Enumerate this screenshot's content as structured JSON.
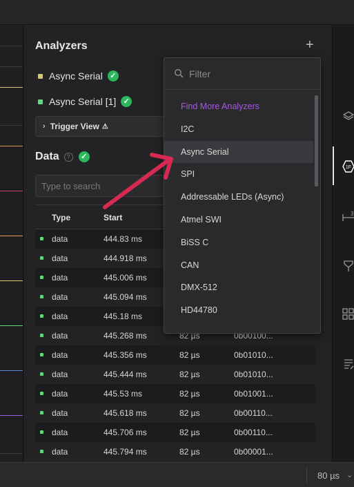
{
  "analyzers": {
    "title": "Analyzers",
    "add_label": "+",
    "items": [
      {
        "name": "Async Serial",
        "color": "#d6c872"
      },
      {
        "name": "Async Serial [1]",
        "color": "#5fd97a"
      }
    ],
    "trigger_view": {
      "label": "Trigger View",
      "chevron": "›",
      "warning": "⚠"
    }
  },
  "data_section": {
    "title": "Data",
    "help": "?",
    "search_placeholder": "Type to search",
    "columns": [
      "Type",
      "Start"
    ],
    "rows": [
      {
        "type": "data",
        "start": "444.83 ms",
        "duration": "",
        "value": ""
      },
      {
        "type": "data",
        "start": "444.918 ms",
        "duration": "",
        "value": ""
      },
      {
        "type": "data",
        "start": "445.006 ms",
        "duration": "",
        "value": ""
      },
      {
        "type": "data",
        "start": "445.094 ms",
        "duration": "",
        "value": ""
      },
      {
        "type": "data",
        "start": "445.18 ms",
        "duration": "",
        "value": ""
      },
      {
        "type": "data",
        "start": "445.268 ms",
        "duration": "82 µs",
        "value": "0b00100..."
      },
      {
        "type": "data",
        "start": "445.356 ms",
        "duration": "82 µs",
        "value": "0b01010..."
      },
      {
        "type": "data",
        "start": "445.444 ms",
        "duration": "82 µs",
        "value": "0b01010..."
      },
      {
        "type": "data",
        "start": "445.53 ms",
        "duration": "82 µs",
        "value": "0b01001..."
      },
      {
        "type": "data",
        "start": "445.618 ms",
        "duration": "82 µs",
        "value": "0b00110..."
      },
      {
        "type": "data",
        "start": "445.706 ms",
        "duration": "82 µs",
        "value": "0b00110..."
      },
      {
        "type": "data",
        "start": "445.794 ms",
        "duration": "82 µs",
        "value": "0b00001..."
      }
    ]
  },
  "dropdown": {
    "filter_placeholder": "Filter",
    "options": [
      {
        "label": "Find More Analyzers",
        "kind": "find"
      },
      {
        "label": "I2C",
        "kind": "normal"
      },
      {
        "label": "Async Serial",
        "kind": "selected"
      },
      {
        "label": "SPI",
        "kind": "normal"
      },
      {
        "label": "Addressable LEDs (Async)",
        "kind": "normal"
      },
      {
        "label": "Atmel SWI",
        "kind": "normal"
      },
      {
        "label": "BiSS C",
        "kind": "normal"
      },
      {
        "label": "CAN",
        "kind": "normal"
      },
      {
        "label": "DMX-512",
        "kind": "normal"
      },
      {
        "label": "HD44780",
        "kind": "normal"
      }
    ]
  },
  "sidebar": {
    "icons": [
      "layers-icon",
      "analyzer-icon",
      "timing-marker-icon",
      "measurement-icon",
      "extensions-icon",
      "notes-icon"
    ],
    "timing_marker_label": "3"
  },
  "bottom_bar": {
    "value": "80 µs",
    "chevron": "⌄"
  },
  "colors": {
    "accent_purple": "#a45adf",
    "check_green": "#2bb75b",
    "annotation_arrow": "#d62a52"
  }
}
